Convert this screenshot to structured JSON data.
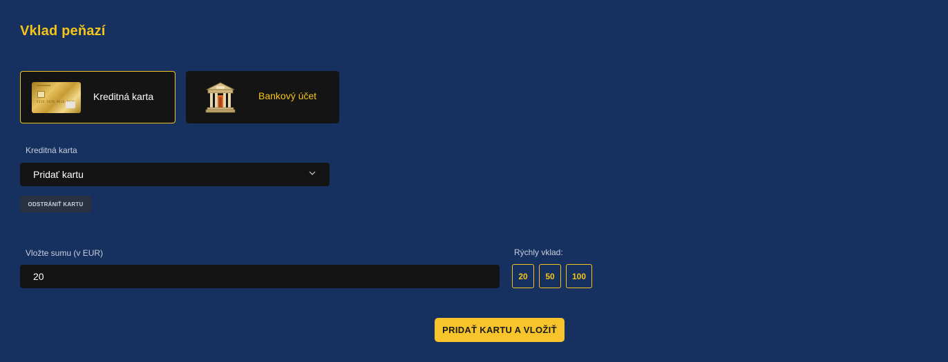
{
  "page": {
    "title": "Vklad peňazí"
  },
  "methods": [
    {
      "label": "Kreditná karta",
      "icon": "credit-card-icon",
      "active": true
    },
    {
      "label": "Bankový účet",
      "icon": "bank-icon",
      "active": false
    }
  ],
  "card_image": {
    "number_text": "5315 5676 9616 9436"
  },
  "card_select": {
    "label": "Kreditná karta",
    "value": "Pridať kartu",
    "icon": "chevron-down-icon"
  },
  "remove_card": {
    "label": "ODSTRÁNIŤ KARTU"
  },
  "amount": {
    "label": "Vložte sumu (v EUR)",
    "value": "20"
  },
  "quick_deposit": {
    "label": "Rýchly vklad:",
    "options": [
      "20",
      "50",
      "100"
    ]
  },
  "submit": {
    "label": "PRIDAŤ KARTU A VLOŽIŤ"
  },
  "colors": {
    "background": "#16305f",
    "accent": "#f5c518",
    "panel": "#141414",
    "button_dark": "#2a3242"
  }
}
